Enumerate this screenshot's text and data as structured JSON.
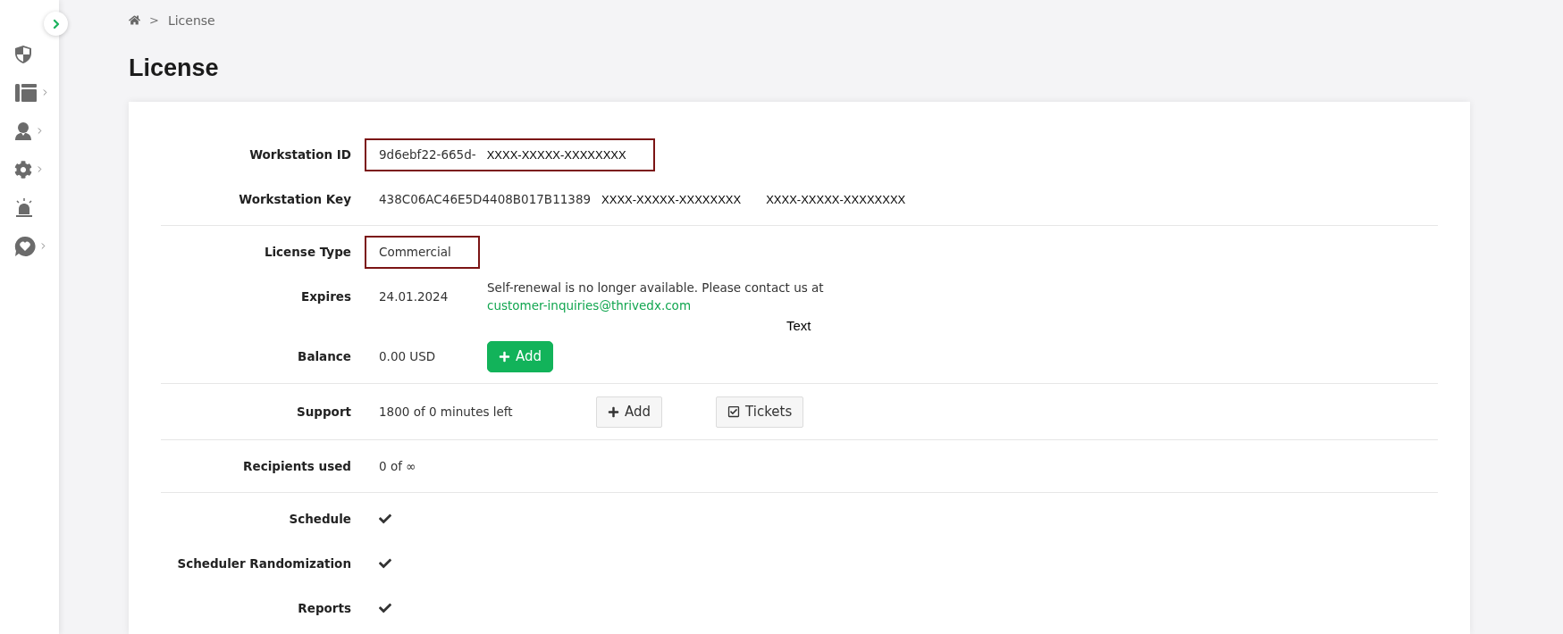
{
  "sidebar": {
    "toggle": {
      "expanded": false
    },
    "items": [
      {
        "has_submenu": false
      },
      {
        "has_submenu": true
      },
      {
        "has_submenu": true
      },
      {
        "has_submenu": true
      },
      {
        "has_submenu": false
      },
      {
        "has_submenu": true
      }
    ]
  },
  "breadcrumb": {
    "separator": ">",
    "items": [
      "License"
    ]
  },
  "title": "License",
  "sections": [
    {
      "rows": [
        {
          "kind": "fields",
          "label": "Workstation ID",
          "highlighted": true,
          "values": [
            "9d6ebf22-665d-",
            "XXXX-XXXXX-XXXXXXXX"
          ]
        },
        {
          "kind": "fields",
          "label": "Workstation Key",
          "highlighted": false,
          "values": [
            "438C06AC46E5D4408B017B11389",
            "XXXX-XXXXX-XXXXXXXX",
            "XXXX-XXXXX-XXXXXXXX"
          ]
        }
      ]
    },
    {
      "rows": [
        {
          "kind": "fields",
          "label": "License Type",
          "highlighted": true,
          "values": [
            "Commercial"
          ]
        },
        {
          "kind": "notice",
          "label": "Expires",
          "value": "24.01.2024",
          "note": "Self-renewal is no longer available. Please contact us at",
          "link": "customer-inquiries@thrivedx.com"
        },
        {
          "kind": "loose",
          "text": "Text"
        },
        {
          "kind": "actions",
          "label": "Balance",
          "value": "0.00 USD",
          "buttons": [
            {
              "label": "Add",
              "kind": "funds"
            }
          ]
        }
      ]
    },
    {
      "rows": [
        {
          "kind": "actions",
          "label": "Support",
          "value": "1800 of 0 minutes left",
          "buttons": [
            {
              "label": "Add",
              "kind": "add"
            },
            {
              "label": "Tickets",
              "kind": "tickets"
            }
          ]
        }
      ]
    },
    {
      "rows": [
        {
          "kind": "fields",
          "label": "Recipients used",
          "highlighted": false,
          "values": [
            "0 of ∞"
          ]
        }
      ]
    },
    {
      "rows": [
        {
          "kind": "feature",
          "label": "Schedule",
          "checked": true
        },
        {
          "kind": "feature",
          "label": "Scheduler Randomization",
          "checked": true
        },
        {
          "kind": "feature",
          "label": "Reports",
          "checked": true
        }
      ]
    }
  ]
}
